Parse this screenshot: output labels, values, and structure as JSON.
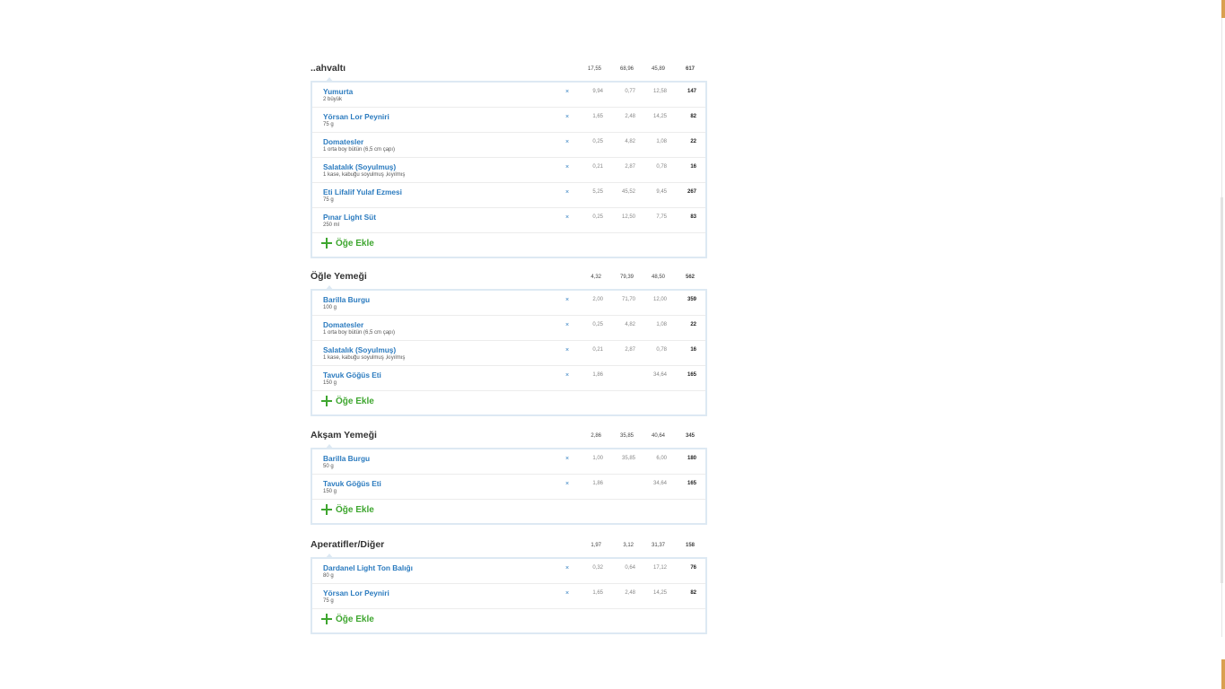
{
  "meals": [
    {
      "title": "..ahvaltı",
      "totals": [
        "17,55",
        "68,96",
        "45,89",
        "617"
      ],
      "items": [
        {
          "name": "Yumurta",
          "amount": "2 büyük",
          "values": [
            "9,94",
            "0,77",
            "12,58",
            "147"
          ]
        },
        {
          "name": "Yörsan Lor Peyniri",
          "amount": "75 g",
          "values": [
            "1,65",
            "2,48",
            "14,25",
            "82"
          ]
        },
        {
          "name": "Domatesler",
          "amount": "1 orta boy bütün (6,5 cm çapı)",
          "values": [
            "0,25",
            "4,82",
            "1,08",
            "22"
          ]
        },
        {
          "name": "Salatalık (Soyulmuş)",
          "amount": "1 kase, kabuğu soyulmuş ,kıyılmış",
          "values": [
            "0,21",
            "2,87",
            "0,78",
            "16"
          ]
        },
        {
          "name": "Eti Lifalif Yulaf Ezmesi",
          "amount": "75 g",
          "values": [
            "5,25",
            "45,52",
            "9,45",
            "267"
          ]
        },
        {
          "name": "Pınar Light Süt",
          "amount": "250 ml",
          "values": [
            "0,25",
            "12,50",
            "7,75",
            "83"
          ]
        }
      ]
    },
    {
      "title": "Öğle Yemeği",
      "totals": [
        "4,32",
        "79,39",
        "48,50",
        "562"
      ],
      "items": [
        {
          "name": "Barilla Burgu",
          "amount": "100 g",
          "values": [
            "2,00",
            "71,70",
            "12,00",
            "359"
          ]
        },
        {
          "name": "Domatesler",
          "amount": "1 orta boy bütün (6,5 cm çapı)",
          "values": [
            "0,25",
            "4,82",
            "1,08",
            "22"
          ]
        },
        {
          "name": "Salatalık (Soyulmuş)",
          "amount": "1 kase, kabuğu soyulmuş ,kıyılmış",
          "values": [
            "0,21",
            "2,87",
            "0,78",
            "16"
          ]
        },
        {
          "name": "Tavuk Göğüs Eti",
          "amount": "150 g",
          "values": [
            "1,86",
            "",
            "34,64",
            "165"
          ]
        }
      ]
    },
    {
      "title": "Akşam Yemeği",
      "totals": [
        "2,86",
        "35,85",
        "40,64",
        "345"
      ],
      "items": [
        {
          "name": "Barilla Burgu",
          "amount": "50 g",
          "values": [
            "1,00",
            "35,85",
            "6,00",
            "180"
          ]
        },
        {
          "name": "Tavuk Göğüs Eti",
          "amount": "150 g",
          "values": [
            "1,86",
            "",
            "34,64",
            "165"
          ]
        }
      ]
    },
    {
      "title": "Aperatifler/Diğer",
      "totals": [
        "1,97",
        "3,12",
        "31,37",
        "158"
      ],
      "items": [
        {
          "name": "Dardanel Light Ton Balığı",
          "amount": "80 g",
          "values": [
            "0,32",
            "0,64",
            "17,12",
            "76"
          ]
        },
        {
          "name": "Yörsan Lor Peyniri",
          "amount": "75 g",
          "values": [
            "1,65",
            "2,48",
            "14,25",
            "82"
          ]
        }
      ]
    }
  ],
  "labels": {
    "add_item": "Öğe Ekle",
    "remove": "×"
  },
  "icons": {
    "add": "plus-icon",
    "remove": "close-icon"
  },
  "colors": {
    "link": "#2b7bbf",
    "add": "#3ea62f",
    "border": "#dde9f3"
  }
}
